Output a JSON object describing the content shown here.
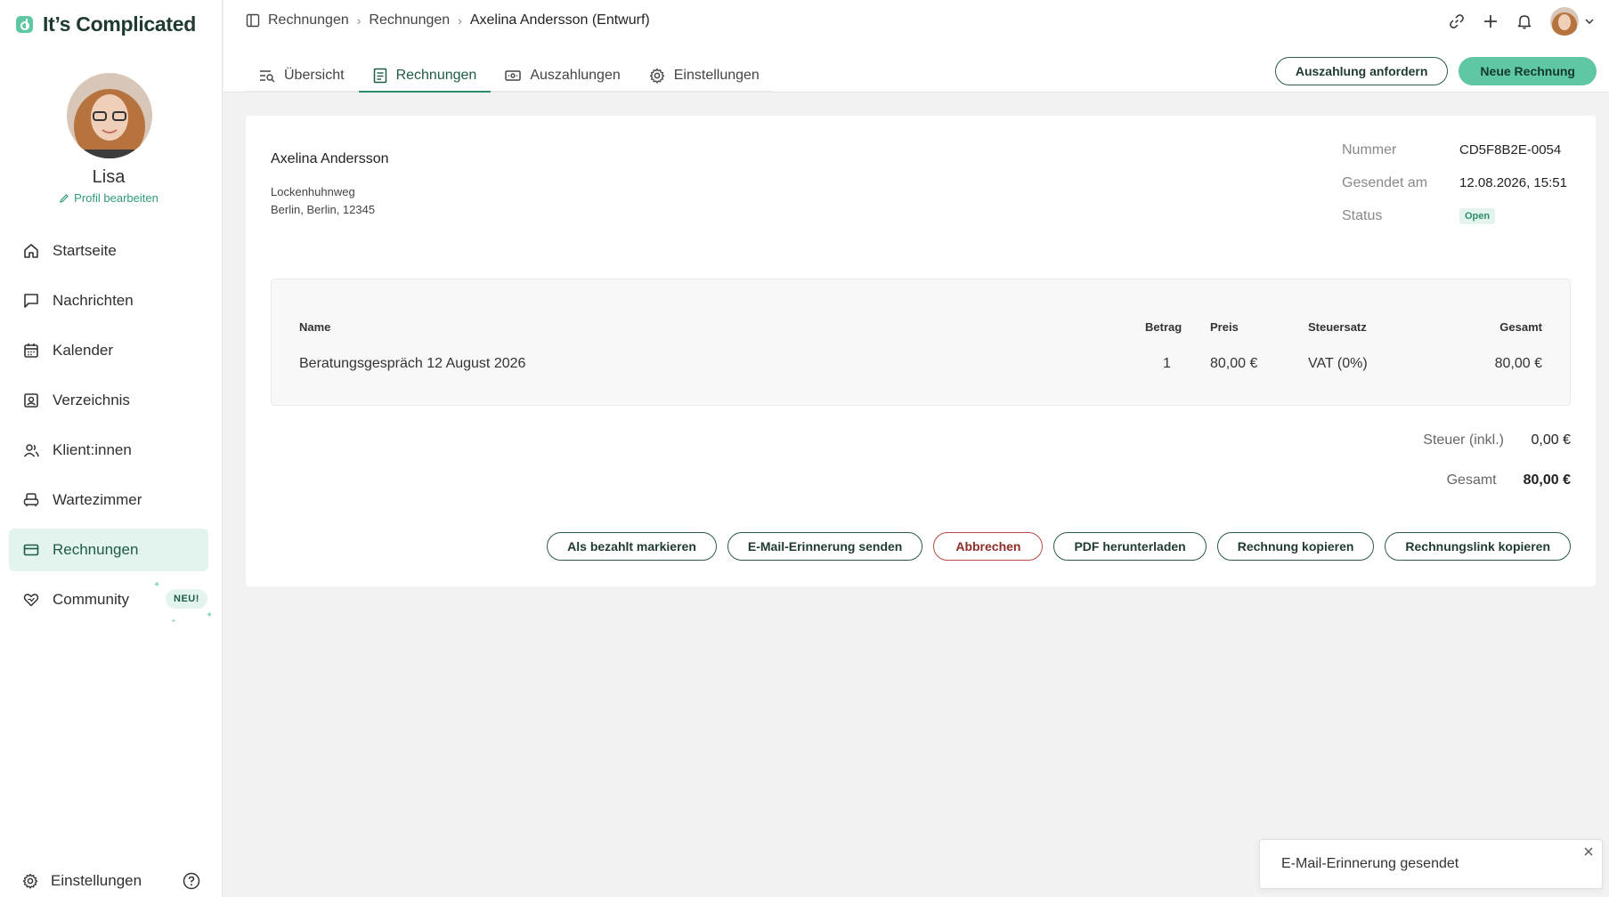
{
  "app": {
    "name": "It’s Complicated",
    "brand_color": "#5fc7a4"
  },
  "profile": {
    "name": "Lisa",
    "edit_label": "Profil bearbeiten"
  },
  "sidebar": {
    "items": [
      {
        "label": "Startseite",
        "icon": "home-icon"
      },
      {
        "label": "Nachrichten",
        "icon": "chat-icon"
      },
      {
        "label": "Kalender",
        "icon": "calendar-icon"
      },
      {
        "label": "Verzeichnis",
        "icon": "directory-icon"
      },
      {
        "label": "Klient:innen",
        "icon": "clients-icon"
      },
      {
        "label": "Wartezimmer",
        "icon": "armchair-icon"
      },
      {
        "label": "Rechnungen",
        "icon": "card-icon",
        "active": true
      },
      {
        "label": "Community",
        "icon": "heart-icon",
        "badge": "NEU!"
      }
    ],
    "footer_label": "Einstellungen"
  },
  "breadcrumb": [
    "Rechnungen",
    "Rechnungen",
    "Axelina Andersson (Entwurf)"
  ],
  "tabs": [
    {
      "label": "Übersicht",
      "icon": "overview-icon"
    },
    {
      "label": "Rechnungen",
      "icon": "invoice-icon",
      "active": true
    },
    {
      "label": "Auszahlungen",
      "icon": "cash-icon"
    },
    {
      "label": "Einstellungen",
      "icon": "gear-icon"
    }
  ],
  "header_actions": {
    "payout": "Auszahlung anfordern",
    "new_invoice": "Neue Rechnung"
  },
  "invoice": {
    "client_name": "Axelina Andersson",
    "address_line1": "Lockenhuhnweg",
    "address_line2": "Berlin, Berlin, 12345",
    "meta": {
      "number_label": "Nummer",
      "number": "CD5F8B2E-0054",
      "sent_label": "Gesendet am",
      "sent": "12.08.2026, 15:51",
      "status_label": "Status",
      "status": "Open"
    },
    "columns": {
      "name": "Name",
      "amount": "Betrag",
      "price": "Preis",
      "tax": "Steuersatz",
      "total": "Gesamt"
    },
    "row": {
      "name": "Beratungsgespräch 12 August 2026",
      "amount": "1",
      "price": "80,00 €",
      "tax": "VAT (0%)",
      "total": "80,00 €"
    },
    "tax_label": "Steuer (inkl.)",
    "tax_value": "0,00 €",
    "total_label": "Gesamt",
    "total_value": "80,00 €"
  },
  "actions": {
    "mark_paid": "Als bezahlt markieren",
    "send_reminder": "E-Mail-Erinnerung senden",
    "cancel": "Abbrechen",
    "download_pdf": "PDF herunterladen",
    "copy_invoice": "Rechnung kopieren",
    "copy_link": "Rechnungslink kopieren"
  },
  "toast": {
    "message": "E-Mail-Erinnerung gesendet"
  }
}
